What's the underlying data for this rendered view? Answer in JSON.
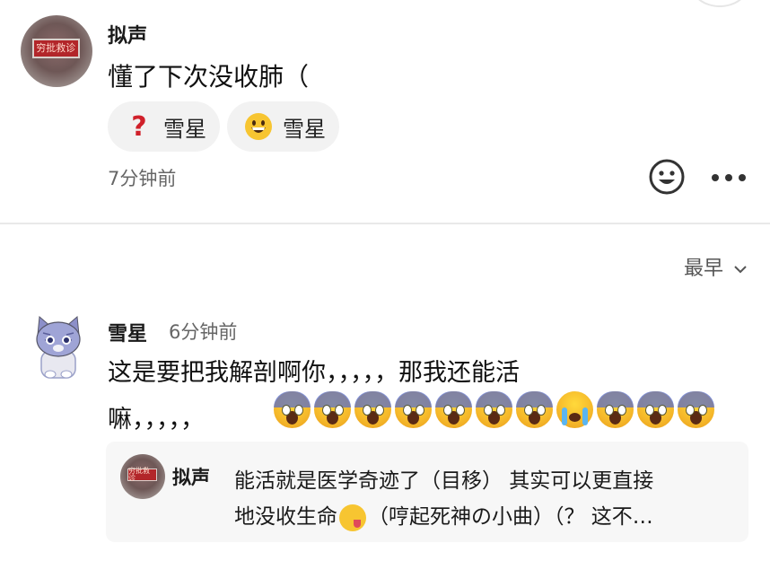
{
  "comment1": {
    "avatar_sign_text": "穷批救诊",
    "username": "拟声",
    "text": "懂了下次没收肺（",
    "reactions": [
      {
        "icon": "question-mark-icon",
        "label": "雪星"
      },
      {
        "icon": "grinning-face-icon",
        "label": "雪星"
      }
    ],
    "time": "7分钟前"
  },
  "sort": {
    "label": "最早"
  },
  "comment2": {
    "username": "雪星",
    "time": "6分钟前",
    "line1": "这是要把我解剖啊你，，，，，那我还能活",
    "line2": "嘛，，，，，",
    "emojis": [
      "face-screaming-icon",
      "face-screaming-icon",
      "face-screaming-icon",
      "face-screaming-icon",
      "face-screaming-icon",
      "face-screaming-icon",
      "face-screaming-icon",
      "loudly-crying-face-icon",
      "face-screaming-icon",
      "face-screaming-icon",
      "face-screaming-icon"
    ]
  },
  "reply": {
    "avatar_sign_text": "穷批救诊",
    "username": "拟声",
    "line1": "能活就是医学奇迹了（目移） 其实可以更直接",
    "line2_a": "地没收生命",
    "line2_b": "（哼起死神の小曲）（？ 这不…"
  },
  "colors": {
    "accent_red": "#d0202a",
    "emoji_yellow": "#f7c531",
    "bg_gray": "#f2f2f2"
  }
}
